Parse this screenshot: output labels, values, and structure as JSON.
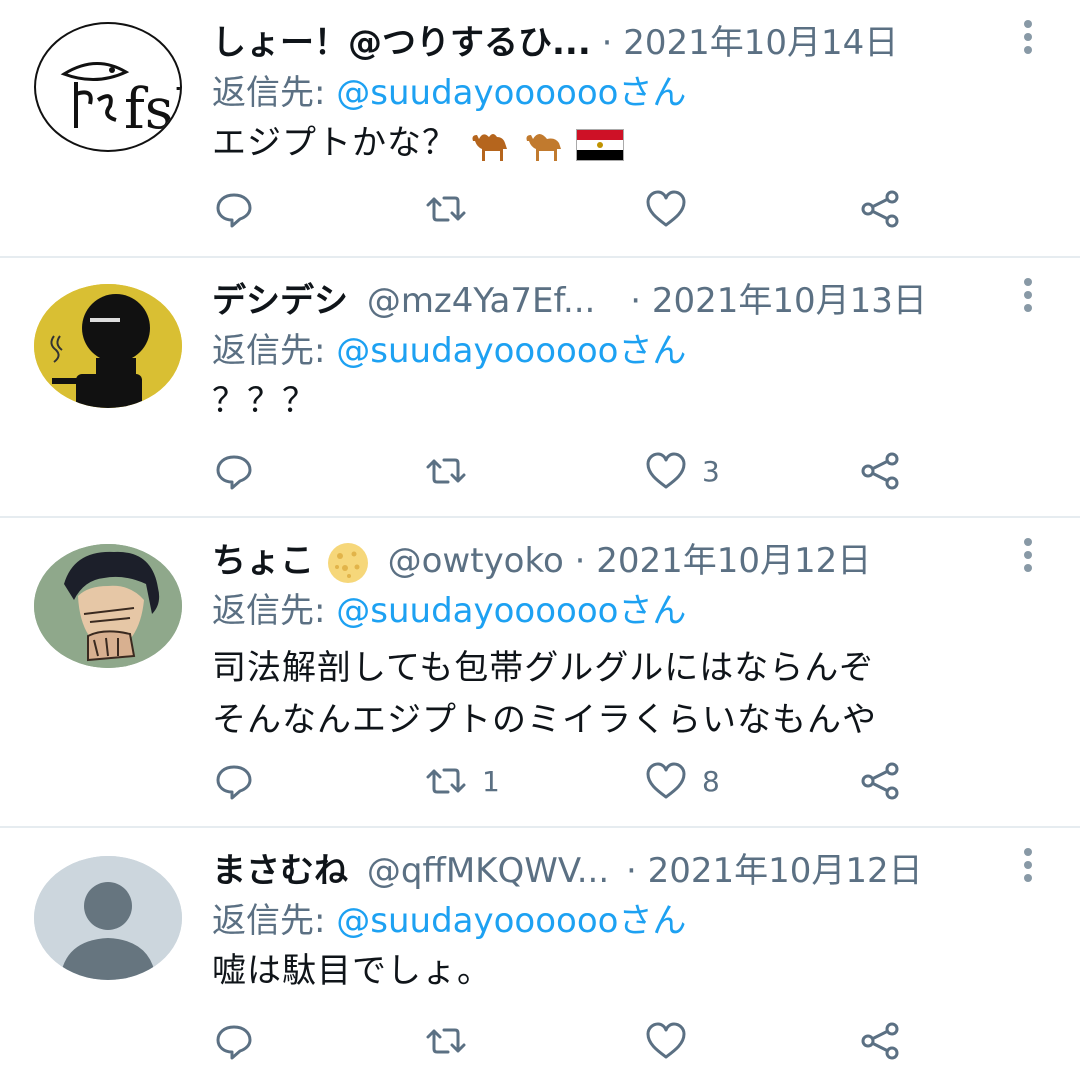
{
  "tweets": [
    {
      "name": "しょー！@つりするひ...",
      "handle": "",
      "date": "2021年10月14日",
      "reply_prefix": "返信先: ",
      "reply_user": "@suudayoooooo",
      "reply_suffix": "さん",
      "text": "エジプトかな？",
      "emoji": [
        "camel-emoji",
        "camel-emoji",
        "egypt-flag-emoji"
      ],
      "avatar": "fish-logo",
      "avatar_text": "fsH",
      "reply_count": "",
      "retweet_count": "",
      "like_count": ""
    },
    {
      "name": "デシデシ",
      "handle": "@mz4Ya7Ef...",
      "date": "2021年10月13日",
      "reply_prefix": "返信先: ",
      "reply_user": "@suudayoooooo",
      "reply_suffix": "さん",
      "text": "？？？",
      "avatar": "silhouette-yellow",
      "reply_count": "",
      "retweet_count": "",
      "like_count": "3"
    },
    {
      "name": "ちょこ",
      "handle": "@owtyoko",
      "date": "2021年10月12日",
      "reply_prefix": "返信先: ",
      "reply_user": "@suudayoooooo",
      "reply_suffix": "さん",
      "text_line1": "司法解剖しても包帯グルグルにはならんぞ",
      "text_line2": "そんなんエジプトのミイラくらいなもんや",
      "name_emoji": "cookie-emoji",
      "avatar": "anime-character",
      "reply_count": "",
      "retweet_count": "1",
      "like_count": "8"
    },
    {
      "name": "まさむね",
      "handle": "@qffMKQWV...",
      "date": "2021年10月12日",
      "reply_prefix": "返信先: ",
      "reply_user": "@suudayoooooo",
      "reply_suffix": "さん",
      "text": "嘘は駄目でしょ。",
      "avatar": "default-profile",
      "reply_count": "",
      "retweet_count": "",
      "like_count": ""
    }
  ],
  "separator": "·",
  "colors": {
    "link": "#1da1f2",
    "muted": "#5b7083",
    "divider": "#e6ecf0",
    "icon": "#5b7083"
  }
}
